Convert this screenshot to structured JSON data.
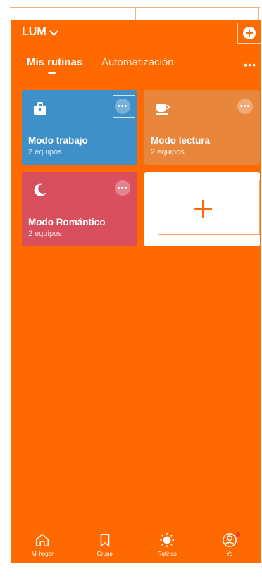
{
  "colors": {
    "primary": "#ff6a00",
    "card_blue": "#3f8fc9",
    "card_orange": "#e8863c",
    "card_red": "#d8505e"
  },
  "header": {
    "home_name": "LUM",
    "add_icon": "plus-circle-icon"
  },
  "tabs": [
    {
      "label": "Mis rutinas",
      "active": true
    },
    {
      "label": "Automatización",
      "active": false
    }
  ],
  "more_top": "•••",
  "cards": [
    {
      "title": "Modo trabajo",
      "subtitle": "2 equipos",
      "icon": "briefcase-icon"
    },
    {
      "title": "Modo lectura",
      "subtitle": "2 equipos",
      "icon": "cup-icon"
    },
    {
      "title": "Modo Romántico",
      "subtitle": "2 equipos",
      "icon": "moon-icon"
    }
  ],
  "card_more_label": "•••",
  "add_card_icon": "plus-icon",
  "bottom_nav": [
    {
      "label": "Mi hogar",
      "icon": "home-icon"
    },
    {
      "label": "Grupo",
      "icon": "bookmark-icon"
    },
    {
      "label": "Rutinas",
      "icon": "sun-icon",
      "active": true
    },
    {
      "label": "Yo",
      "icon": "user-icon"
    }
  ]
}
